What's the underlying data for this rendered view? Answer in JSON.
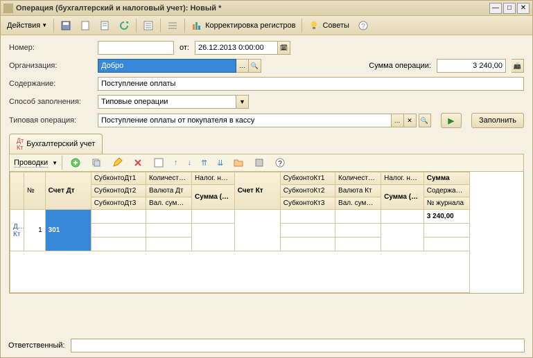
{
  "window": {
    "title": "Операция (бухгалтерский и налоговый учет): Новый *"
  },
  "toolbar": {
    "actions": "Действия",
    "registers": "Корректировка регистров",
    "tips": "Советы"
  },
  "form": {
    "number_label": "Номер:",
    "from_label": "от:",
    "date_value": "26.12.2013 0:00:00",
    "org_label": "Организация:",
    "org_value": "Добро",
    "sum_label": "Сумма операции:",
    "sum_value": "3 240,00",
    "content_label": "Содержание:",
    "content_value": "Поступление оплаты",
    "fill_method_label": "Способ заполнения:",
    "fill_method_value": "Типовые операции",
    "typical_op_label": "Типовая операция:",
    "typical_op_value": "Поступление оплаты от покупателя в кассу",
    "execute_label": "Заполнить"
  },
  "tab": {
    "label": "Бухгалтерский учет"
  },
  "subtoolbar": {
    "label": "Проводки"
  },
  "grid": {
    "headers": {
      "num": "№",
      "dt": "Счет Дт",
      "subdt1": "СубконтоДт1",
      "subdt2": "СубконтоДт2",
      "subdt3": "СубконтоДт3",
      "qty": "Количеств…",
      "valdt": "Валюта Дт",
      "valsum": "Вал. сумм…",
      "tax": "Налог. на…",
      "sumdt": "Сумма (н/у) Дт",
      "kt": "Счет Кт",
      "subkt1": "СубконтоКт1",
      "subkt2": "СубконтоКт2",
      "subkt3": "СубконтоКт3",
      "qtyk": "Количеств…",
      "valkt": "Валюта Кт",
      "valsumk": "Вал. сумм…",
      "taxk": "Налог. на…",
      "sumkt": "Сумма (н/у) Кт",
      "sum": "Сумма",
      "content": "Содержание",
      "journal": "№ журнала"
    },
    "rows": [
      {
        "num": "1",
        "dt": "301",
        "sum": "3 240,00"
      }
    ]
  },
  "footer": {
    "responsible_label": "Ответственный:"
  }
}
